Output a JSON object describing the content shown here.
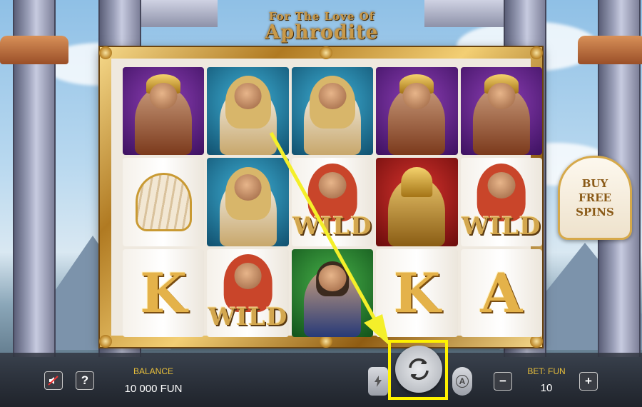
{
  "game": {
    "title_line1": "For The Love Of",
    "title_line2": "Aphrodite"
  },
  "reels": [
    [
      "hermes",
      "blonde-warrior",
      "blonde-warrior",
      "hermes",
      "hermes"
    ],
    [
      "golden-shell",
      "blonde-warrior",
      "wild",
      "spartan",
      "wild"
    ],
    [
      "K",
      "wild",
      "bearded-god",
      "K",
      "A"
    ]
  ],
  "symbols": {
    "wild_label": "WILD",
    "letter_K": "K",
    "letter_A": "A"
  },
  "buy_free_spins": {
    "line1": "BUY",
    "line2": "FREE",
    "line3": "SPINS"
  },
  "controls": {
    "sound_icon": "speaker-muted-icon",
    "info_label": "?",
    "balance_label": "BALANCE",
    "balance_value": "10 000 FUN",
    "turbo_icon": "lightning-icon",
    "spin_icon": "refresh-icon",
    "autoplay_icon": "autoplay-icon",
    "autoplay_letter": "A",
    "bet_label": "BET: FUN",
    "bet_minus": "−",
    "bet_value": "10",
    "bet_plus": "+"
  },
  "overlay": {
    "highlight_color": "#fff200",
    "arrow_color": "#f4ef2a"
  }
}
